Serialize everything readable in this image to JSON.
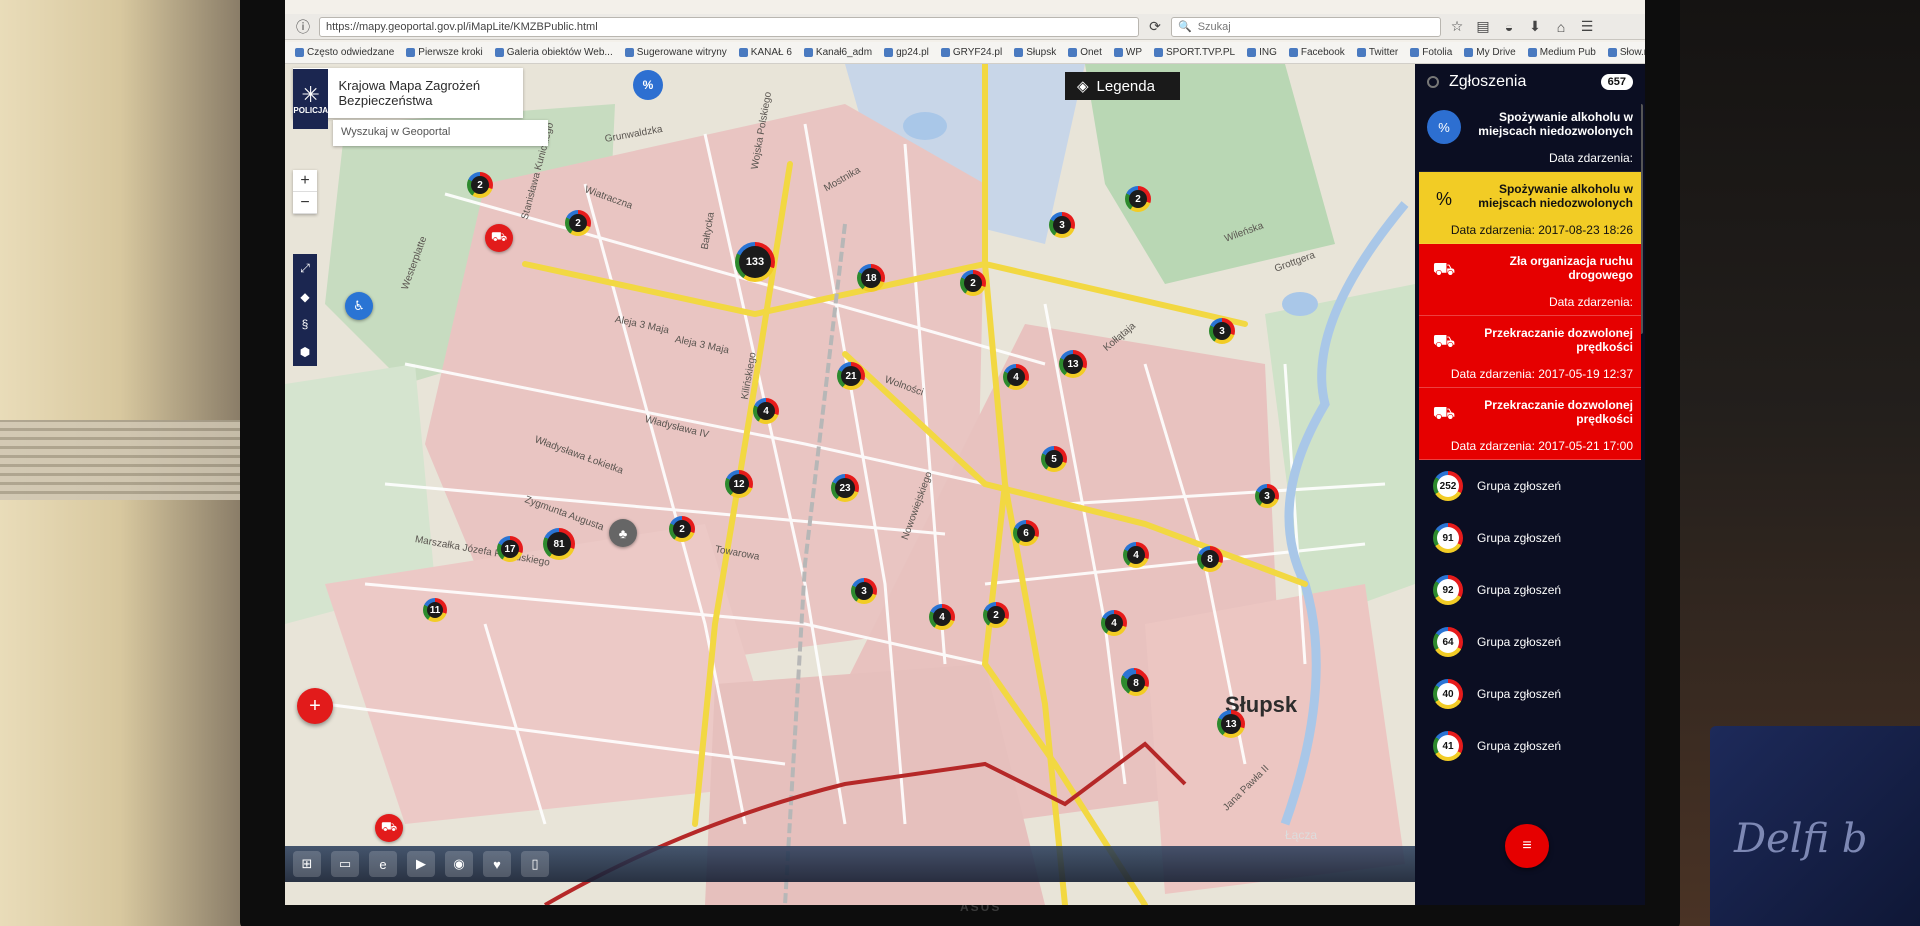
{
  "browser": {
    "url": "https://mapy.geoportal.gov.pl/iMapLite/KMZBPublic.html",
    "search_placeholder": "Szukaj",
    "bookmarks": [
      "Często odwiedzane",
      "Pierwsze kroki",
      "Galeria obiektów Web...",
      "Sugerowane witryny",
      "KANAŁ 6",
      "Kanał6_adm",
      "gp24.pl",
      "GRYF24.pl",
      "Słupsk",
      "Onet",
      "WP",
      "SPORT.TVP.PL",
      "ING",
      "Facebook",
      "Twitter",
      "Fotolia",
      "My Drive",
      "Medium Pub",
      "Słow.muz."
    ]
  },
  "app": {
    "logo_text": "POLICJA",
    "title": "Krajowa Mapa Zagrożeń Bezpieczeństwa",
    "geoportal_search_placeholder": "Wyszukaj w Geoportal",
    "legend_label": "Legenda",
    "city_label": "Słupsk"
  },
  "map": {
    "streets": [
      "Grunwaldzka",
      "Wiatraczna",
      "Stanisława Kunickiego",
      "Wojska Polskiego",
      "Aleja 3 Maja",
      "Aleja 3 Maja",
      "Bałtycka",
      "Zygmunta Augusta",
      "Władysława IV",
      "Władysława Łokietka",
      "Marszałka Józefa Piłsudskiego",
      "Westerplatte",
      "Wolności",
      "Kilińskiego",
      "Towarowa",
      "Mostnika",
      "Nowowiejskiego",
      "Wileńska",
      "Kołłątaja",
      "Grottgera",
      "Jana Pawła II"
    ],
    "clusters": [
      "133",
      "18",
      "2",
      "2",
      "2",
      "21",
      "4",
      "12",
      "23",
      "17",
      "81",
      "2",
      "3",
      "4",
      "2",
      "4",
      "13",
      "3",
      "4",
      "2",
      "5",
      "4",
      "6",
      "5",
      "8",
      "8",
      "13",
      "3",
      "11",
      "3"
    ]
  },
  "sidebar": {
    "header": "Zgłoszenia",
    "count": "657",
    "cards": [
      {
        "type": "dark",
        "title": "Spożywanie alkoholu w miejscach niedozwolonych",
        "date": "Data zdarzenia:"
      },
      {
        "type": "yellow",
        "title": "Spożywanie alkoholu w miejscach niedozwolonych",
        "date": "Data zdarzenia: 2017-08-23 18:26"
      },
      {
        "type": "red",
        "title": "Zła organizacja ruchu drogowego",
        "date": "Data zdarzenia:"
      },
      {
        "type": "red",
        "title": "Przekraczanie dozwolonej prędkości",
        "date": "Data zdarzenia: 2017-05-19 12:37"
      },
      {
        "type": "red",
        "title": "Przekraczanie dozwolonej prędkości",
        "date": "Data zdarzenia: 2017-05-21 17:00"
      }
    ],
    "groups": [
      {
        "count": "252",
        "label": "Grupa zgłoszeń"
      },
      {
        "count": "91",
        "label": "Grupa zgłoszeń"
      },
      {
        "count": "92",
        "label": "Grupa zgłoszeń"
      },
      {
        "count": "64",
        "label": "Grupa zgłoszeń"
      },
      {
        "count": "40",
        "label": "Grupa zgłoszeń"
      },
      {
        "count": "41",
        "label": "Grupa zgłoszeń"
      }
    ]
  },
  "taskbar": {
    "clock": "Łącza"
  },
  "monitor": {
    "brand": "ASUS"
  },
  "room": {
    "box_text": "Delfi b"
  },
  "colors": {
    "police_navy": "#1b2650",
    "alert_red": "#e60000",
    "warning_yellow": "#f2cc25",
    "sidebar_bg": "#0b0e22",
    "road_yellow": "#f2d842",
    "building_pink": "#e3b8b4"
  },
  "icons": {
    "bookmark": "bookmark-icon",
    "home": "home-icon",
    "download": "download-icon",
    "menu": "hamburger-menu-icon",
    "alcohol": "bottle-percent-icon",
    "car": "car-warning-icon",
    "layers": "layers-icon",
    "filter": "filter-icon"
  }
}
